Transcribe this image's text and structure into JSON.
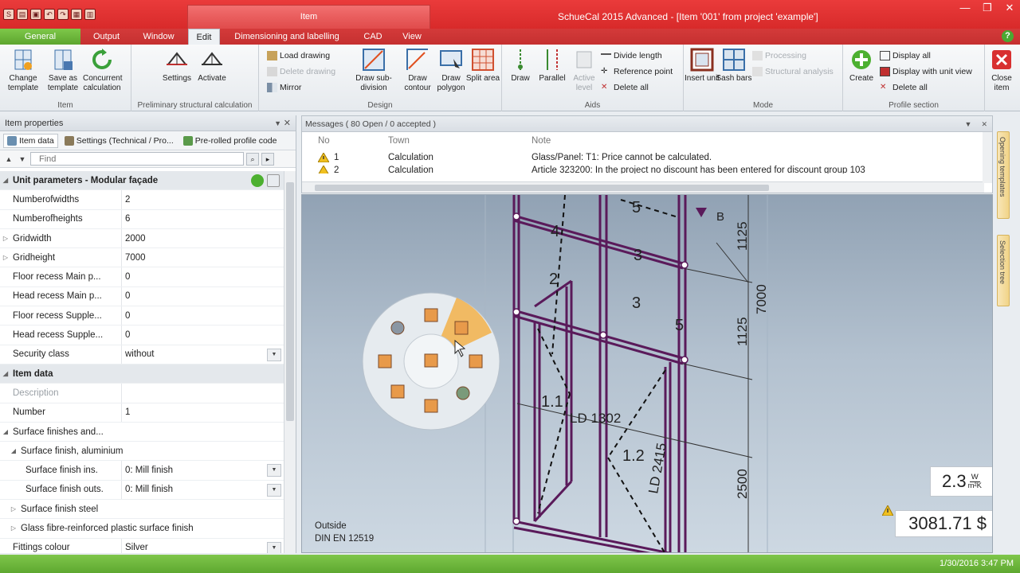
{
  "window": {
    "title": "SchueCal 2015 Advanced - [Item '001' from project 'example']",
    "context_tab_title": "Item",
    "controls": [
      "—",
      "❐",
      "✕"
    ]
  },
  "tabs": [
    {
      "label": "General",
      "state": "green"
    },
    {
      "label": "Output"
    },
    {
      "label": "Window"
    },
    {
      "label": "Edit",
      "state": "active"
    },
    {
      "label": "Dimensioning and labelling"
    },
    {
      "label": "CAD"
    },
    {
      "label": "View"
    }
  ],
  "ribbon": {
    "groups": {
      "item": "Item",
      "prelim": "Preliminary structural calculation",
      "design": "Design",
      "aids": "Aids",
      "mode": "Mode",
      "profile_section": "Profile section"
    },
    "buttons": {
      "change_template": "Change template",
      "save_as_template": "Save as template",
      "concurrent_calculation": "Concurrent calculation",
      "settings": "Settings",
      "activate": "Activate",
      "load_drawing": "Load drawing",
      "delete_drawing": "Delete drawing",
      "mirror": "Mirror",
      "draw_subdivision": "Draw sub-division",
      "draw_contour": "Draw contour",
      "draw_polygon": "Draw polygon",
      "split_area": "Split area",
      "draw": "Draw",
      "parallel": "Parallel",
      "active_level": "Active level",
      "divide_length": "Divide length",
      "reference_point": "Reference point",
      "delete_all_aids": "Delete all",
      "insert_unit": "Insert unit",
      "sash_bars": "Sash bars",
      "processing": "Processing",
      "structural_analysis": "Structural analysis",
      "create": "Create",
      "display_all": "Display all",
      "display_with_unit_view": "Display with unit view",
      "delete_all_profile": "Delete all",
      "close_item": "Close item"
    }
  },
  "item_properties": {
    "title": "Item properties",
    "tabs": [
      "Item data",
      "Settings (Technical / Pro...",
      "Pre-rolled profile code"
    ],
    "find_placeholder": "Find",
    "rows": [
      {
        "type": "section",
        "name": "Unit parameters - Modular façade"
      },
      {
        "name": "Numberofwidths",
        "value": "2"
      },
      {
        "name": "Numberofheights",
        "value": "6"
      },
      {
        "name": "Gridwidth",
        "value": "2000",
        "expand": true
      },
      {
        "name": "Gridheight",
        "value": "7000",
        "expand": true
      },
      {
        "name": "Floor recess Main p...",
        "value": "0"
      },
      {
        "name": "Head recess Main p...",
        "value": "0"
      },
      {
        "name": "Floor recess Supple...",
        "value": "0"
      },
      {
        "name": "Head recess Supple...",
        "value": "0"
      },
      {
        "name": "Security class",
        "value": "without",
        "dropdown": true
      },
      {
        "type": "section",
        "name": "Item data"
      },
      {
        "name": "Description",
        "value": "",
        "dim": true
      },
      {
        "name": "Number",
        "value": "1"
      },
      {
        "type": "sub",
        "name": "Surface finishes and...",
        "level": 0
      },
      {
        "type": "sub",
        "name": "Surface finish, aluminium",
        "level": 1
      },
      {
        "name": "Surface finish ins.",
        "value": "0: Mill finish",
        "dropdown": true,
        "level": 2
      },
      {
        "name": "Surface finish outs.",
        "value": "0: Mill finish",
        "dropdown": true,
        "level": 2
      },
      {
        "type": "sub",
        "name": "Surface finish steel",
        "level": 1,
        "expand": true
      },
      {
        "type": "sub",
        "name": "Glass fibre-reinforced plastic surface finish",
        "level": 1,
        "expand": true
      },
      {
        "name": "Fittings colour",
        "value": "Silver",
        "dropdown": true
      }
    ]
  },
  "messages": {
    "header": "Messages ( 80 Open / 0 accepted )",
    "columns": [
      "No",
      "Town",
      "Note"
    ],
    "rows": [
      {
        "no": "1",
        "town": "Calculation",
        "note": "Glass/Panel: T1: Price cannot be calculated."
      },
      {
        "no": "2",
        "town": "Calculation",
        "note": "Article 323200: In the project no discount has been entered for discount group 103"
      }
    ]
  },
  "side_tabs": [
    "Opening templates",
    "Selection tree"
  ],
  "viewport": {
    "view_label": "Outside",
    "standard": "DIN EN 12519",
    "u_value": "2.3",
    "u_unit_top": "W",
    "u_unit_bottom": "m²K",
    "price": "3081.71 $",
    "dims": [
      "1125",
      "7000",
      "1125",
      "2500"
    ],
    "labels": [
      "5",
      "4",
      "3",
      "2",
      "3",
      "5",
      "1.1",
      "1.2",
      "LD 1302",
      "LD 2415",
      "B"
    ]
  },
  "status": {
    "datetime": "1/30/2016 3:47 PM"
  },
  "colors": {
    "titlebar": "#d82a2a",
    "accent_green": "#5da52e",
    "frame_purple": "#5a1a5a"
  }
}
